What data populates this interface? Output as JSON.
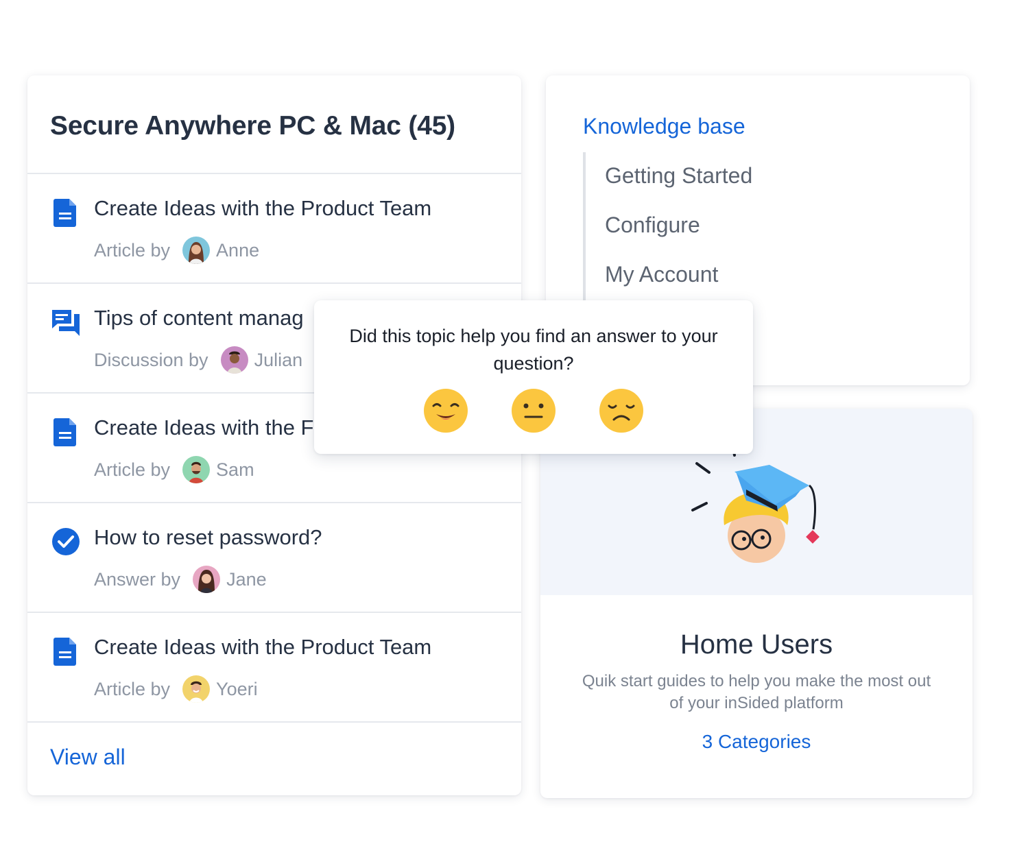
{
  "topic_list": {
    "title": "Secure Anywhere PC & Mac (45)",
    "items": [
      {
        "type_icon": "document-icon",
        "title": "Create Ideas with the Product Team",
        "meta_type": "Article by",
        "author": "Anne"
      },
      {
        "type_icon": "discussion-icon",
        "title": "Tips of content manag",
        "meta_type": "Discussion by",
        "author": "Julian"
      },
      {
        "type_icon": "document-icon",
        "title": "Create Ideas with the F",
        "meta_type": "Article by",
        "author": "Sam"
      },
      {
        "type_icon": "check-circle-icon",
        "title": "How to reset password?",
        "meta_type": "Answer by",
        "author": "Jane"
      },
      {
        "type_icon": "document-icon",
        "title": "Create Ideas with the Product Team",
        "meta_type": "Article by",
        "author": "Yoeri"
      }
    ],
    "view_all": "View all"
  },
  "knowledge_base": {
    "title": "Knowledge base",
    "items": [
      "Getting Started",
      "Configure",
      "My Account"
    ]
  },
  "home_users": {
    "title": "Home Users",
    "description": "Quik start guides to help you make the most out of your inSided platform",
    "link": "3 Categories",
    "illustration_icon": "graduate-with-cap-icon"
  },
  "feedback": {
    "question": "Did this topic help you find an answer to your question?",
    "options": [
      "happy-face-icon",
      "neutral-face-icon",
      "sad-face-icon"
    ]
  },
  "colors": {
    "accent": "#1565d8",
    "text_dark": "#263143",
    "text_muted": "#8e96a3",
    "emoji_yellow": "#fbc63f"
  }
}
